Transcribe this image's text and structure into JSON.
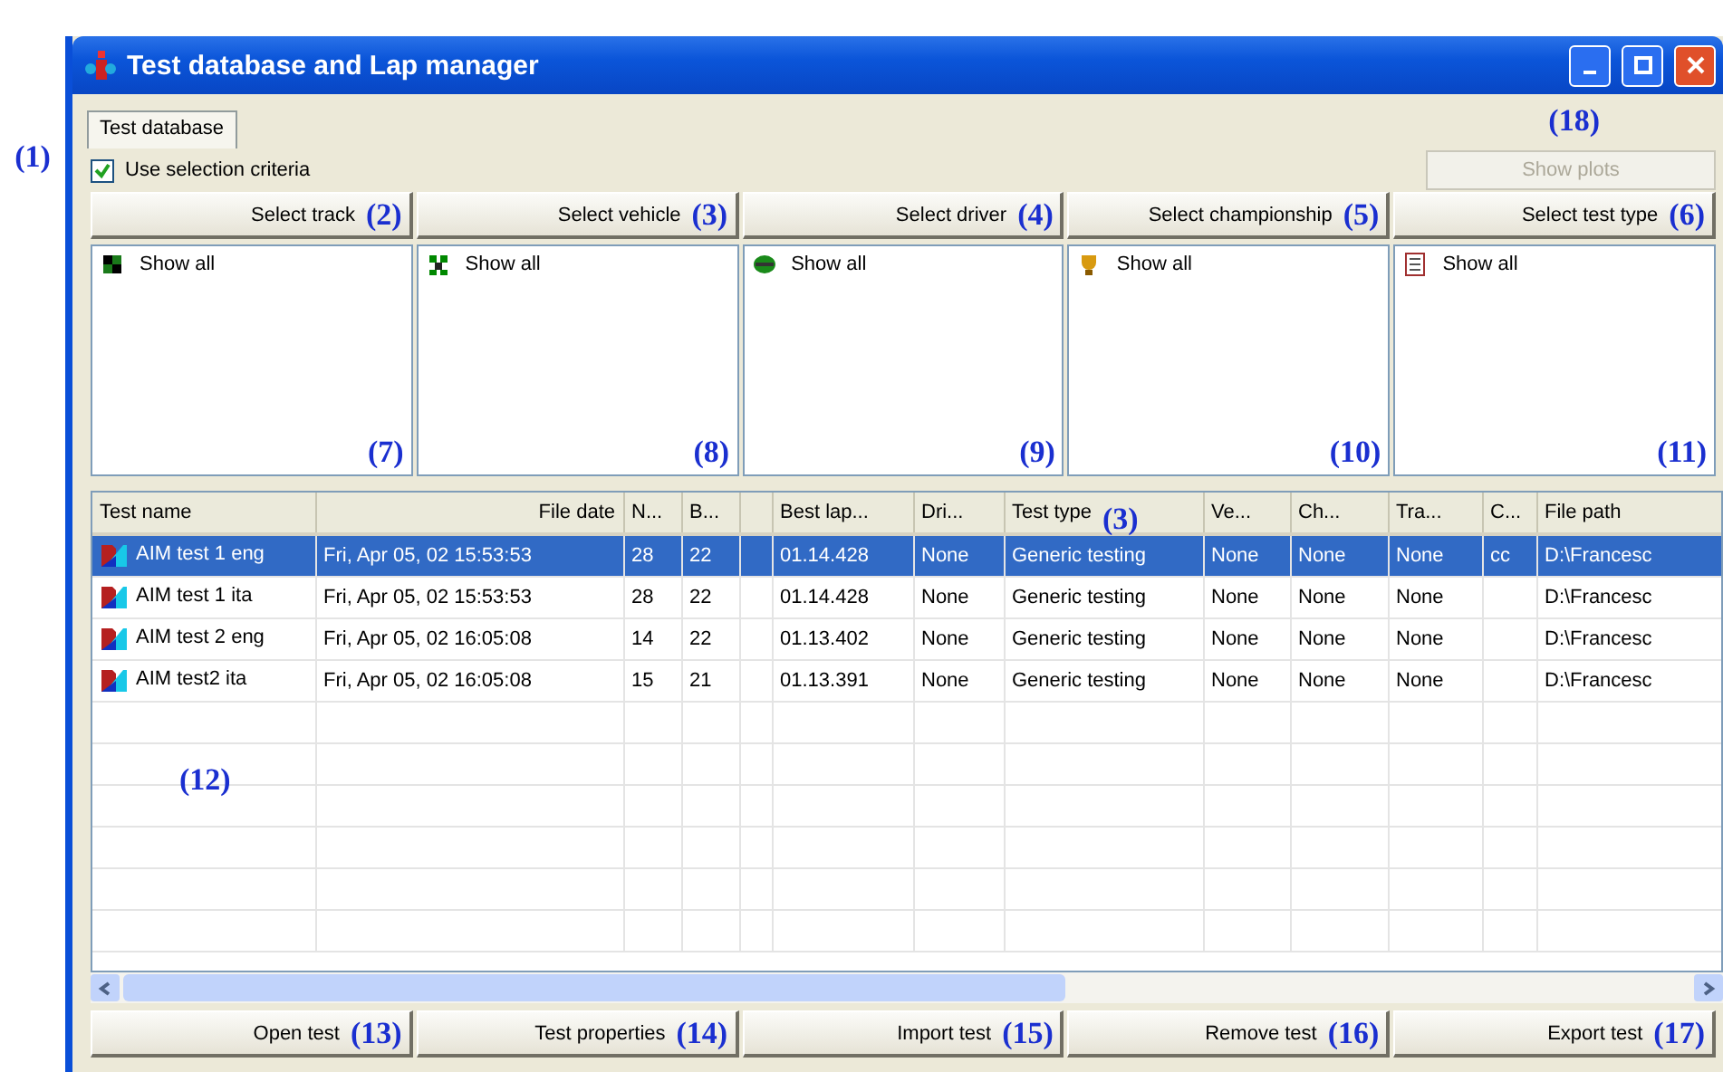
{
  "window": {
    "title": "Test database and Lap manager"
  },
  "outer_callout": "(1)",
  "tabs": [
    {
      "label": "Test database",
      "selected": true
    }
  ],
  "selection_criteria": {
    "label": "Use selection criteria",
    "checked": true
  },
  "show_plots": {
    "label": "Show plots",
    "disabled": true,
    "callout": "(18)"
  },
  "filters": [
    {
      "button": "Select track",
      "callout": "(2)",
      "item": "Show all",
      "list_callout": "(7)"
    },
    {
      "button": "Select vehicle",
      "callout": "(3)",
      "item": "Show all",
      "list_callout": "(8)"
    },
    {
      "button": "Select driver",
      "callout": "(4)",
      "item": "Show all",
      "list_callout": "(9)"
    },
    {
      "button": "Select championship",
      "callout": "(5)",
      "item": "Show all",
      "list_callout": "(10)"
    },
    {
      "button": "Select test type",
      "callout": "(6)",
      "item": "Show all",
      "list_callout": "(11)"
    }
  ],
  "table": {
    "columns": [
      {
        "label": "Test name"
      },
      {
        "label": "File date"
      },
      {
        "label": "N..."
      },
      {
        "label": "B..."
      },
      {},
      {
        "label": "Best lap..."
      },
      {
        "label": "Dri..."
      },
      {
        "label": "Test type",
        "callout": "(3)"
      },
      {
        "label": "Ve..."
      },
      {
        "label": "Ch..."
      },
      {
        "label": "Tra..."
      },
      {
        "label": "C..."
      },
      {
        "label": "File path"
      }
    ],
    "rows": [
      {
        "selected": true,
        "cells": [
          "AIM test 1 eng",
          "Fri, Apr 05, 02  15:53:53",
          "28",
          "22",
          "",
          "01.14.428",
          "None",
          "Generic testing",
          "None",
          "None",
          "None",
          "cc",
          "D:\\Francesc"
        ]
      },
      {
        "selected": false,
        "cells": [
          "AIM test 1 ita",
          "Fri, Apr 05, 02  15:53:53",
          "28",
          "22",
          "",
          "01.14.428",
          "None",
          "Generic testing",
          "None",
          "None",
          "None",
          "",
          "D:\\Francesc"
        ]
      },
      {
        "selected": false,
        "cells": [
          "AIM test 2 eng",
          "Fri, Apr 05, 02  16:05:08",
          "14",
          "22",
          "",
          "01.13.402",
          "None",
          "Generic testing",
          "None",
          "None",
          "None",
          "",
          "D:\\Francesc"
        ]
      },
      {
        "selected": false,
        "cells": [
          "AIM test2 ita",
          "Fri, Apr 05, 02  16:05:08",
          "15",
          "21",
          "",
          "01.13.391",
          "None",
          "Generic testing",
          "None",
          "None",
          "None",
          "",
          "D:\\Francesc"
        ]
      }
    ],
    "callout": "(12)"
  },
  "actions": [
    {
      "label": "Open test",
      "callout": "(13)"
    },
    {
      "label": "Test properties",
      "callout": "(14)"
    },
    {
      "label": "Import test",
      "callout": "(15)"
    },
    {
      "label": "Remove test",
      "callout": "(16)"
    },
    {
      "label": "Export test",
      "callout": "(17)"
    }
  ]
}
